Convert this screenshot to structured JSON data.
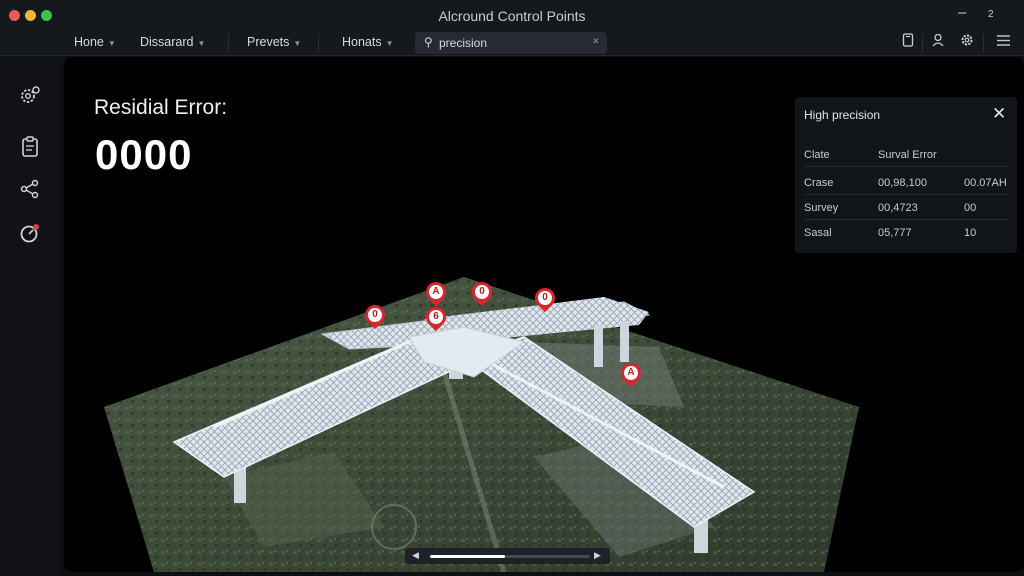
{
  "window": {
    "title": "Alcround Control Points",
    "minimize_label": "–",
    "extra_label": "2"
  },
  "menu": [
    {
      "label": "Hone"
    },
    {
      "label": "Dissarard"
    },
    {
      "label": "Prevets"
    },
    {
      "label": "Honats"
    }
  ],
  "search": {
    "value": "precision",
    "icon": "search-icon"
  },
  "toolbar_icons": [
    "document-icon",
    "user-icon",
    "gear-icon",
    "list-icon"
  ],
  "sidebar_icons": [
    "settings-icon",
    "clipboard-icon",
    "share-icon",
    "target-icon"
  ],
  "residual": {
    "label": "Residial Error:",
    "value": "0000"
  },
  "markers": [
    "0",
    "A",
    "0",
    "0",
    "6",
    "A"
  ],
  "panel": {
    "title": "High precision",
    "headers": [
      "Clate",
      "Surval Error"
    ],
    "rows": [
      {
        "c1": "Crase",
        "c2": "00,98,100",
        "c3": "00.07AH"
      },
      {
        "c1": "Survey",
        "c2": "00,4723",
        "c3": "00"
      },
      {
        "c1": "Sasal",
        "c2": "05,777",
        "c3": "10"
      }
    ]
  },
  "timeline": {
    "progress": 0.47
  },
  "colors": {
    "accent": "#d9262c",
    "background": "#000000",
    "panel": "#111418"
  }
}
